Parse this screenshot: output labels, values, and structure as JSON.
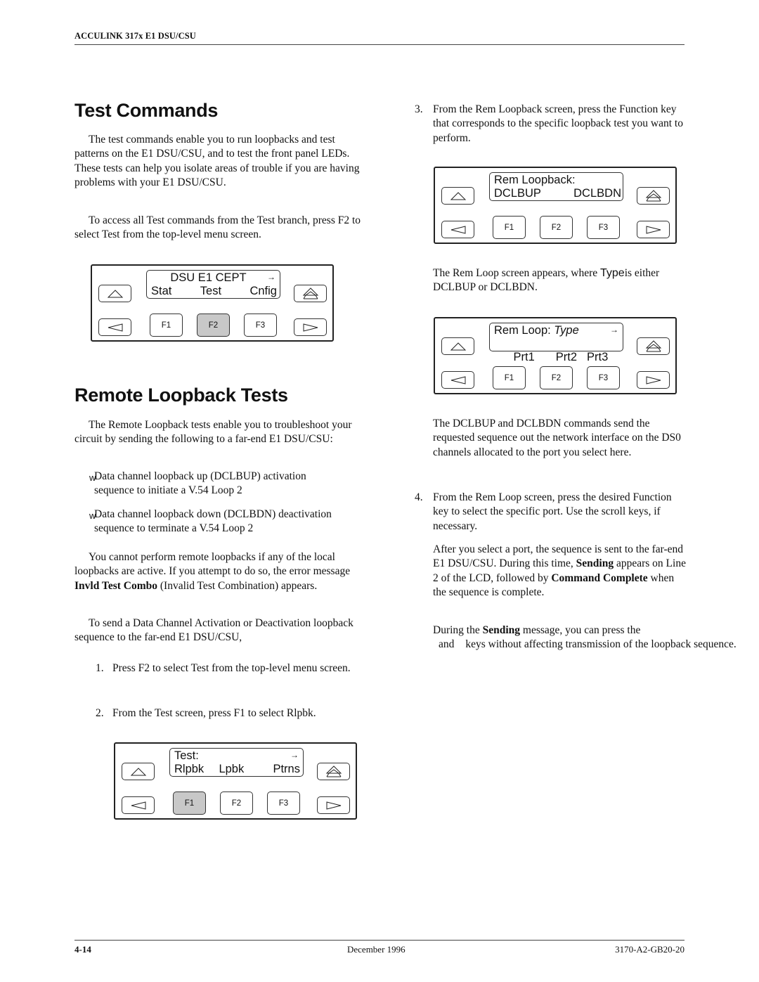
{
  "header": {
    "title": "ACCULINK 317x E1 DSU/CSU"
  },
  "footer": {
    "page_number": "4-14",
    "date": "December 1996",
    "doc_number": "3170-A2-GB20-20"
  },
  "left_column": {
    "test_commands": {
      "heading": "Test Commands",
      "para1": "The test commands enable you to run loopbacks and test patterns on the E1 DSU/CSU, and to test the front panel LEDs. These tests can help you isolate areas of trouble if you are having problems with your E1 DSU/CSU.",
      "para2": "To access all Test commands from the Test branch, press F2 to select Test from the top-level menu screen."
    },
    "remote_loopback": {
      "heading": "Remote Loopback Tests",
      "intro": "The Remote Loopback tests enable you to troubleshoot your circuit by sending the following to a far-end E1 DSU/CSU:",
      "bullets": [
        {
          "mark": "w",
          "text": "Data channel loopback up (DCLBUP) activation sequence to initiate a V.54 Loop 2"
        },
        {
          "mark": "w",
          "text": "Data channel loopback down (DCLBDN) deactivation sequence to terminate a V.54 Loop 2"
        }
      ],
      "warning_pre": "You cannot perform remote loopbacks if any of the local loopbacks are active. If you attempt to do so, the error message ",
      "warning_bold": "Invld Test Combo",
      "warning_post": " (Invalid Test Combination) appears.",
      "send_intro": "To send a Data Channel Activation or Deactivation loopback sequence to the far-end E1 DSU/CSU,",
      "steps": [
        {
          "num": "1.",
          "text": "Press F2 to select Test from the top-level menu screen."
        },
        {
          "num": "2.",
          "text": "From the Test screen, press F1 to select Rlpbk."
        }
      ]
    }
  },
  "right_column": {
    "step3": {
      "num": "3.",
      "text": "From the Rem Loopback screen, press the Function key that corresponds to the specific loopback test you want to perform."
    },
    "rem_loop_note_pre": "The Rem Loop screen appears, where ",
    "rem_loop_note_type": "Type",
    "rem_loop_note_post": "is either DCLBUP or DCLBDN.",
    "dclb_para": "The DCLBUP and DCLBDN commands send the requested sequence out the network interface on the DS0 channels allocated to the port you select here.",
    "step4": {
      "num": "4.",
      "text": "From the Rem Loop screen, press the desired Function key to select the specific port. Use the scroll keys, if necessary."
    },
    "after_pre": "After you select a port, the sequence is sent to the far-end E1 DSU/CSU. During this time, ",
    "after_bold1": "Sending",
    "after_mid": " appears on Line 2 of the LCD, followed by ",
    "after_bold2": "Command Complete",
    "after_post": " when the sequence is complete.",
    "during_pre": "During the ",
    "during_bold": "Sending",
    "during_mid": " message, you can press the",
    "during_and": "and",
    "during_post": "keys without affecting transmission of the loopback sequence."
  },
  "panels": {
    "top_menu": {
      "line1": "DSU E1 CEPT",
      "line2": [
        "Stat",
        "Test",
        "Cnfig"
      ],
      "has_scroll_arrow": true,
      "scroll_arrow": "→",
      "fkeys": [
        "F1",
        "F2",
        "F3"
      ],
      "pressed_key": "F2"
    },
    "rem_loopback": {
      "line1": "Rem Loopback:",
      "line2": [
        "DCLBUP",
        "DCLBDN"
      ],
      "has_scroll_arrow": false,
      "fkeys": [
        "F1",
        "F2",
        "F3"
      ],
      "pressed_key": ""
    },
    "rem_loop": {
      "line1_prefix": "Rem Loop: ",
      "line1_italic": "Type",
      "line2": [
        "Prt1",
        "Prt2",
        "Prt3"
      ],
      "has_scroll_arrow": true,
      "scroll_arrow": "→",
      "fkeys": [
        "F1",
        "F2",
        "F3"
      ],
      "pressed_key": ""
    },
    "test": {
      "line1": "Test:",
      "line2": [
        "Rlpbk",
        "Lpbk",
        "Ptrns"
      ],
      "has_scroll_arrow": true,
      "scroll_arrow": "→",
      "fkeys": [
        "F1",
        "F2",
        "F3"
      ],
      "pressed_key": "F1"
    }
  },
  "icons": {
    "up_arrow": "up-arrow-icon",
    "page_up": "page-up-icon",
    "left_arrow": "left-arrow-icon",
    "right_arrow": "right-arrow-icon"
  }
}
